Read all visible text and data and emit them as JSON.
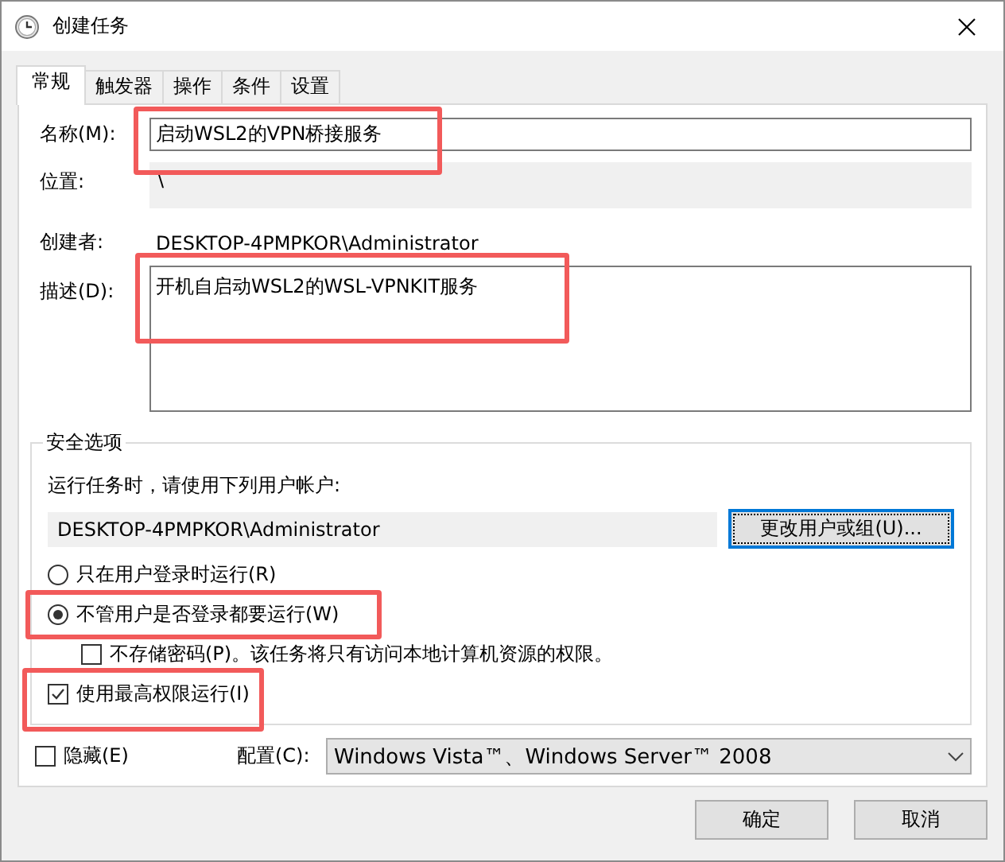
{
  "window": {
    "title": "创建任务"
  },
  "tabs": [
    {
      "label": "常规",
      "selected": true
    },
    {
      "label": "触发器",
      "selected": false
    },
    {
      "label": "操作",
      "selected": false
    },
    {
      "label": "条件",
      "selected": false
    },
    {
      "label": "设置",
      "selected": false
    }
  ],
  "general": {
    "name_label": "名称(M):",
    "name_value": "启动WSL2的VPN桥接服务",
    "name_highlighted": true,
    "location_label": "位置:",
    "location_value": "\\",
    "author_label": "创建者:",
    "author_value": "DESKTOP-4PMPKOR\\Administrator",
    "description_label": "描述(D):",
    "description_value": "开机自启动WSL2的WSL-VPNKIT服务",
    "description_highlighted": true
  },
  "security": {
    "title": "安全选项",
    "prompt": "运行任务时，请使用下列用户帐户:",
    "user_account": "DESKTOP-4PMPKOR\\Administrator",
    "change_button": "更改用户或组(U)...",
    "options": [
      {
        "kind": "radio",
        "label": "只在用户登录时运行(R)",
        "selected": false,
        "highlighted": false
      },
      {
        "kind": "radio",
        "label": "不管用户是否登录都要运行(W)",
        "selected": true,
        "highlighted": true,
        "children": [
          {
            "kind": "checkbox",
            "label": "不存储密码(P)。该任务将只有访问本地计算机资源的权限。",
            "checked": false,
            "highlighted": false
          }
        ]
      },
      {
        "kind": "checkbox",
        "label": "使用最高权限运行(I)",
        "checked": true,
        "highlighted": true
      }
    ]
  },
  "hidden": {
    "label": "隐藏(E)",
    "checked": false
  },
  "config": {
    "label": "配置(C):",
    "value": "Windows Vista™、Windows Server™ 2008"
  },
  "buttons": [
    "确定",
    "取消"
  ]
}
